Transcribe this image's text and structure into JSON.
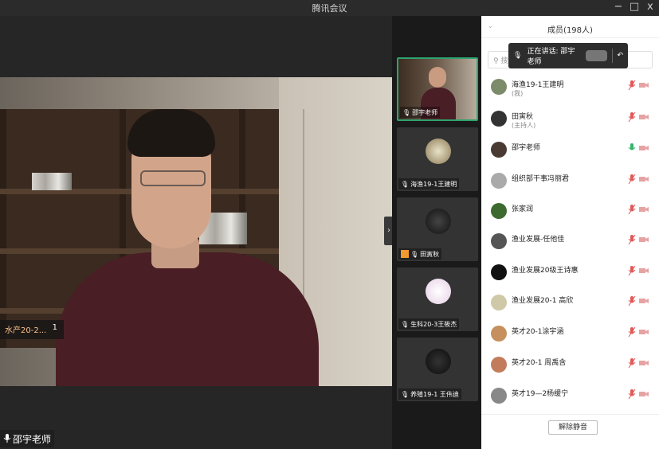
{
  "window": {
    "title": "腾讯会议",
    "minimize": "−",
    "maximize": "□",
    "close": "x"
  },
  "main_video": {
    "overlay_label": "水产20-2...",
    "overlay_count": "1",
    "speaker_name": "邵宇老师"
  },
  "strip": {
    "thumbs": [
      {
        "name": "邵宇老师"
      },
      {
        "name": "海渔19-1王建明"
      },
      {
        "name": "田寅秋"
      },
      {
        "name": "生科20-3王筱杰"
      },
      {
        "name": "养殖19-1 王伟迪"
      }
    ]
  },
  "members": {
    "title": "成员(198人)",
    "search_placeholder": "搜",
    "speaking_prefix": "正在讲话: 邵宇老师",
    "list": [
      {
        "name": "海渔19-1王建明",
        "sub": "(我)"
      },
      {
        "name": "田寅秋",
        "sub": "(主持人)"
      },
      {
        "name": "邵宇老师",
        "sub": ""
      },
      {
        "name": "组织部干事冯丽君",
        "sub": ""
      },
      {
        "name": "张家润",
        "sub": ""
      },
      {
        "name": "渔业发展-任他佳",
        "sub": ""
      },
      {
        "name": "渔业发展20级王诗惠",
        "sub": ""
      },
      {
        "name": "渔业发展20-1 高欣",
        "sub": ""
      },
      {
        "name": "英才20-1涂宇涵",
        "sub": ""
      },
      {
        "name": "英才20-1 周禹含",
        "sub": ""
      },
      {
        "name": "英才19—2杨缓宁",
        "sub": ""
      }
    ],
    "unmute_label": "解除静音"
  },
  "colors": {
    "active_border": "#2ea36e",
    "mic_muted": "#e05a5a",
    "mic_active": "#34b36b"
  }
}
